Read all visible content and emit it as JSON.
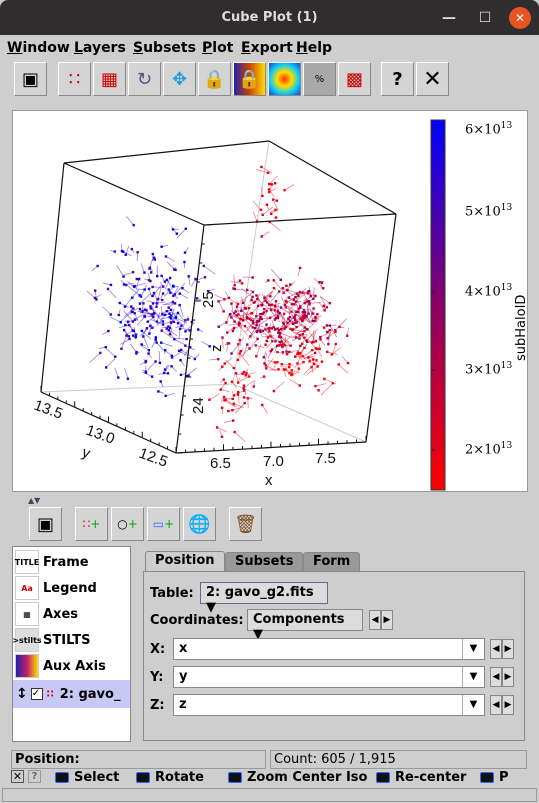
{
  "window": {
    "title": "Cube Plot (1)"
  },
  "menu": [
    {
      "label": "Window",
      "key": "W"
    },
    {
      "label": "Layers",
      "key": "L"
    },
    {
      "label": "Subsets",
      "key": "S"
    },
    {
      "label": "Plot",
      "key": "P"
    },
    {
      "label": "Export",
      "key": "E"
    },
    {
      "label": "Help",
      "key": "H"
    }
  ],
  "toolbar": [
    "window-icon",
    "blob-subset-icon",
    "polygon-subset-icon",
    "replot-icon",
    "navigate-icon",
    "lock-axes-icon",
    "lock-aux-icon",
    "density-icon",
    "progress-icon",
    "export-icon",
    "help-icon",
    "close-icon"
  ],
  "chart_data": {
    "type": "scatter",
    "projection": "3d-cube",
    "x": {
      "label": "x",
      "ticks": [
        "6.5",
        "7.0",
        "7.5"
      ]
    },
    "y": {
      "label": "y",
      "ticks": [
        "13.5",
        "13.0",
        "12.5"
      ]
    },
    "z": {
      "label": "z",
      "ticks": [
        "24",
        "25"
      ]
    },
    "colorbar": {
      "label": "subHaloID",
      "ticks": [
        "6×10^13",
        "5×10^13",
        "4×10^13",
        "3×10^13",
        "2×10^13"
      ],
      "range": [
        15000000000000.0,
        62000000000000.0
      ],
      "colormap": [
        "#ff0000",
        "#8a0066",
        "#0000ff"
      ]
    },
    "marker": "point with vector arrows",
    "count_shown": 605
  },
  "colorbar_labels": [
    {
      "m": "6",
      "e": "13"
    },
    {
      "m": "5",
      "e": "13"
    },
    {
      "m": "4",
      "e": "13"
    },
    {
      "m": "3",
      "e": "13"
    },
    {
      "m": "2",
      "e": "13"
    }
  ],
  "layers": [
    {
      "label": "Frame"
    },
    {
      "label": "Legend"
    },
    {
      "label": "Axes"
    },
    {
      "label": "STILTS"
    },
    {
      "label": "Aux Axis"
    },
    {
      "label": "2: gavo_",
      "checked": true
    }
  ],
  "tabs": [
    {
      "label": "Position"
    },
    {
      "label": "Subsets"
    },
    {
      "label": "Form"
    }
  ],
  "position": {
    "table_label": "Table:",
    "table_value": "2: gavo_g2.fits",
    "coords_label": "Coordinates:",
    "coords_value": "Components",
    "x_label": "X:",
    "x_value": "x",
    "y_label": "Y:",
    "y_value": "y",
    "z_label": "Z:",
    "z_value": "z"
  },
  "status": {
    "position": "Position:",
    "count": "Count: 605 / 1,915"
  },
  "modes": [
    "Select",
    "Rotate",
    "Zoom Center Iso",
    "Re-center",
    "P"
  ]
}
